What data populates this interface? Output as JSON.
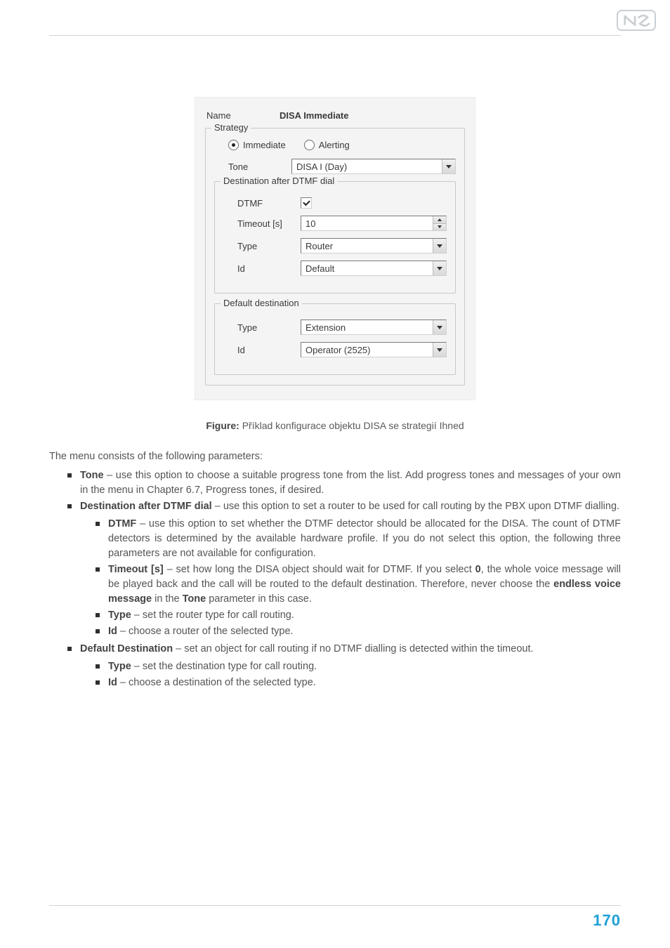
{
  "panel": {
    "name_label": "Name",
    "name_value": "DISA Immediate",
    "groups": {
      "strategy": {
        "legend": "Strategy",
        "radio": {
          "immediate": "Immediate",
          "alerting": "Alerting",
          "selected": "immediate"
        },
        "tone": {
          "label": "Tone",
          "value": "DISA I (Day)"
        },
        "dtmf_group": {
          "legend": "Destination after DTMF dial",
          "dtmf": {
            "label": "DTMF",
            "checked": true
          },
          "timeout": {
            "label": "Timeout [s]",
            "value": "10"
          },
          "type": {
            "label": "Type",
            "value": "Router"
          },
          "id": {
            "label": "Id",
            "value": "Default"
          }
        },
        "default_dest": {
          "legend": "Default destination",
          "type": {
            "label": "Type",
            "value": "Extension"
          },
          "id": {
            "label": "Id",
            "value": "Operator (2525)"
          }
        }
      }
    }
  },
  "caption": {
    "prefix": "Figure: ",
    "text": "Příklad konfigurace objektu DISA se strategií Ihned"
  },
  "intro": "The menu consists of the following parameters:",
  "bullets": {
    "tone": {
      "h": "Tone",
      "t": " – use this option to choose a suitable progress tone from the list. Add progress tones and messages of your own in the menu in Chapter 6.7, Progress tones, if desired."
    },
    "dest_after": {
      "h": "Destination after DTMF dial",
      "t": " – use this option to set a router to be used for call routing by the PBX upon DTMF dialling."
    },
    "dtmf": {
      "h": "DTMF",
      "t": " – use this option to set whether the DTMF detector should be allocated for the DISA. The count of DTMF detectors is determined by the available hardware profile. If you do not select this option, the following three parameters are not available for configuration."
    },
    "timeout": {
      "h": "Timeout [s]",
      "t1": " – set how long the DISA object should wait for DTMF. If you select ",
      "zero": "0",
      "t2": ", the whole voice message will be played back and the call will be routed to the default destination. Therefore, never choose the ",
      "endless": "endless voice message",
      "in_the": " in the ",
      "tone_word": "Tone",
      "tail": " parameter in this case."
    },
    "type": {
      "h": "Type",
      "t": " – set the router type for call routing."
    },
    "id": {
      "h": "Id",
      "t": " – choose a router of the selected type."
    },
    "default_dest": {
      "h": "Default Destination",
      "t": " – set an object for call routing if no DTMF dialling is detected within the timeout."
    },
    "dd_type": {
      "h": "Type",
      "t": " – set the destination type for call routing."
    },
    "dd_id": {
      "h": "Id",
      "t": " – choose a destination of the selected type."
    }
  },
  "page_number": "170"
}
